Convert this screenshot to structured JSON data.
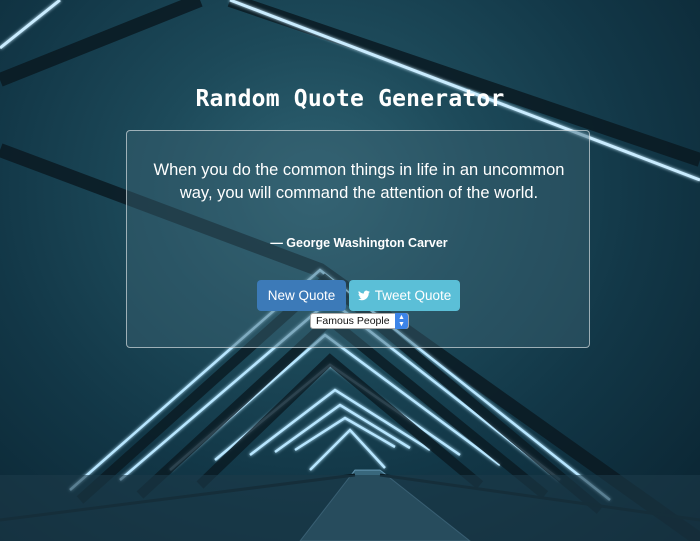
{
  "header": {
    "title": "Random Quote Generator"
  },
  "quote": {
    "text": "When you do the common things in life in an uncommon way, you will command the attention of the world.",
    "author": "— George Washington Carver"
  },
  "buttons": {
    "new_quote": "New Quote",
    "tweet_quote": "Tweet Quote"
  },
  "category_select": {
    "selected": "Famous People"
  },
  "icons": {
    "tweet": "twitter-bird-icon",
    "select": "chevron-updown-icon"
  },
  "colors": {
    "new_quote_bg": "#3c7ab8",
    "tweet_bg": "#5bbfd7",
    "glow": "#9fdcff"
  }
}
